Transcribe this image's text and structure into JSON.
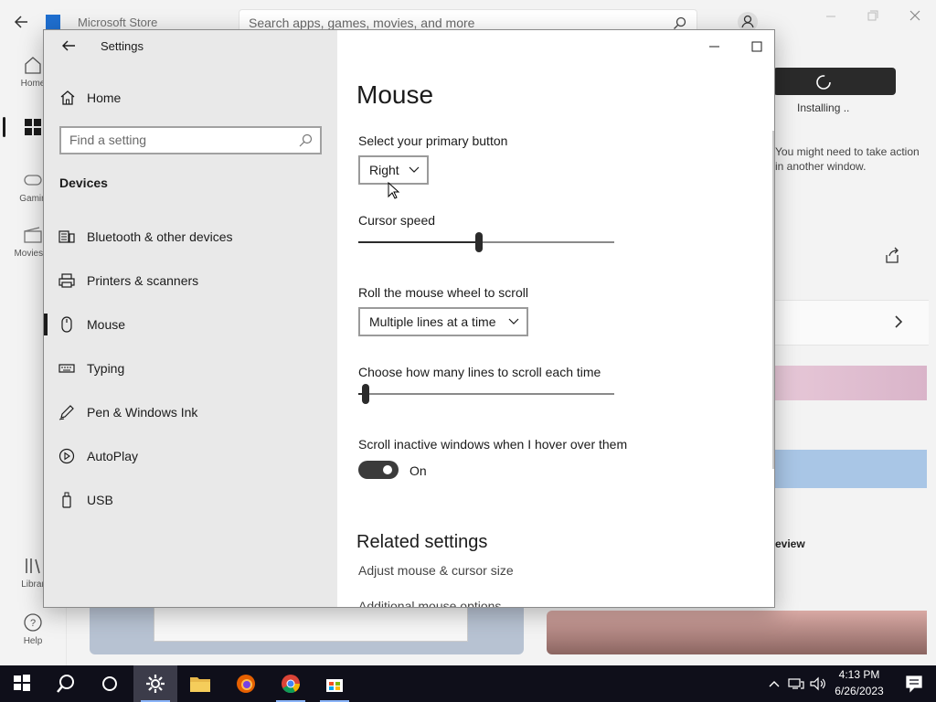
{
  "store": {
    "title": "Microsoft Store",
    "search_placeholder": "Search apps, games, movies, and more",
    "rail": [
      {
        "label": "Home",
        "icon": "home-icon"
      },
      {
        "label": "",
        "icon": "apps-icon"
      },
      {
        "label": "Gamin",
        "icon": "gamepad-icon"
      },
      {
        "label": "Movies &",
        "icon": "clapper-icon"
      },
      {
        "label": "Librar",
        "icon": "library-icon"
      },
      {
        "label": "Help",
        "icon": "help-icon"
      }
    ],
    "installing_label": "Installing ..",
    "note_text": "You might need to take action in another window.",
    "review_text": "eview"
  },
  "settings": {
    "window_title": "Settings",
    "nav": {
      "home_label": "Home",
      "search_placeholder": "Find a setting",
      "section_title": "Devices",
      "items": [
        {
          "label": "Bluetooth & other devices",
          "icon": "bluetooth-devices-icon"
        },
        {
          "label": "Printers & scanners",
          "icon": "printer-icon"
        },
        {
          "label": "Mouse",
          "icon": "mouse-icon",
          "active": true
        },
        {
          "label": "Typing",
          "icon": "keyboard-icon"
        },
        {
          "label": "Pen & Windows Ink",
          "icon": "pen-icon"
        },
        {
          "label": "AutoPlay",
          "icon": "autoplay-icon"
        },
        {
          "label": "USB",
          "icon": "usb-icon"
        }
      ]
    },
    "content": {
      "page_title": "Mouse",
      "primary_button": {
        "label": "Select your primary button",
        "value": "Right"
      },
      "cursor_speed": {
        "label": "Cursor speed",
        "level": 0.47
      },
      "wheel_scroll": {
        "label": "Roll the mouse wheel to scroll",
        "value": "Multiple lines at a time"
      },
      "scroll_lines": {
        "label": "Choose how many lines to scroll each time",
        "level": 0.03
      },
      "inactive_scroll": {
        "label": "Scroll inactive windows when I hover over them",
        "state": "On"
      },
      "related": {
        "title": "Related settings",
        "links": [
          "Adjust mouse & cursor size",
          "Additional mouse options"
        ]
      }
    }
  },
  "taskbar": {
    "time": "4:13 PM",
    "date": "6/26/2023",
    "apps": [
      "start-icon",
      "search-icon",
      "cortana-icon",
      "settings-icon",
      "file-explorer-icon",
      "firefox-icon",
      "chrome-icon",
      "store-icon"
    ]
  },
  "colors": {
    "accent_dark": "#2b2b2b",
    "nav_bg": "#e9e9e9",
    "taskbar_bg": "#0f0f1a"
  }
}
